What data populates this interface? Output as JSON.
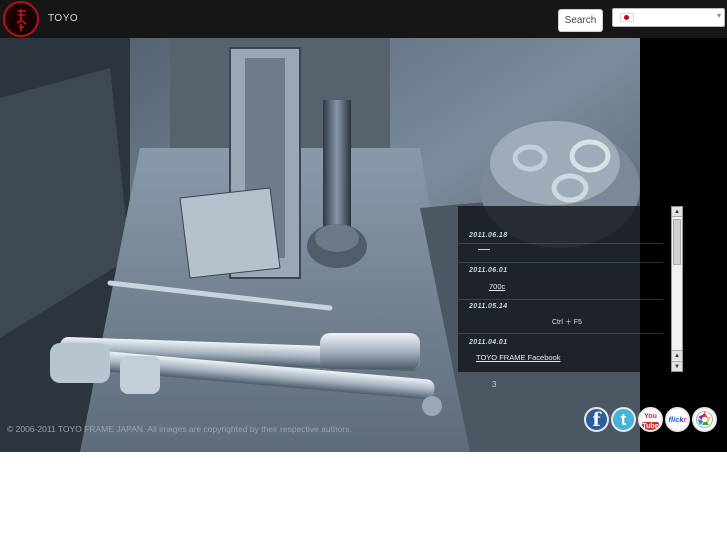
{
  "header": {
    "brand": "TOYO",
    "search_label": "Search",
    "language": {
      "flag": "japan-flag-icon"
    }
  },
  "news": {
    "items": [
      {
        "date": "2011.06.18",
        "link": ""
      },
      {
        "date": "2011.06.01",
        "link": "700c"
      },
      {
        "date": "2011.05.14",
        "link": ""
      },
      {
        "date": "2011.04.01",
        "link": "TOYO FRAME Facebook"
      }
    ]
  },
  "hint": "Ctrl ＋ F5",
  "page_number": "3",
  "footer": {
    "copyright": "© 2006-2011 TOYO FRAME JAPAN. All images are copyrighted by their respective authors."
  },
  "social": [
    {
      "icon": "facebook-icon",
      "glyph": "f"
    },
    {
      "icon": "twitter-icon",
      "glyph": "t"
    },
    {
      "icon": "youtube-icon",
      "top": "You",
      "bottom": "Tube"
    },
    {
      "icon": "flickr-icon",
      "a": "flick",
      "b": "r"
    },
    {
      "icon": "picasa-icon"
    }
  ],
  "colors": {
    "topbar": "#161616",
    "logo_red": "#b0141c",
    "facebook": "#2d5c9b",
    "twitter": "#44b3e0",
    "youtube": "#c4302b"
  }
}
